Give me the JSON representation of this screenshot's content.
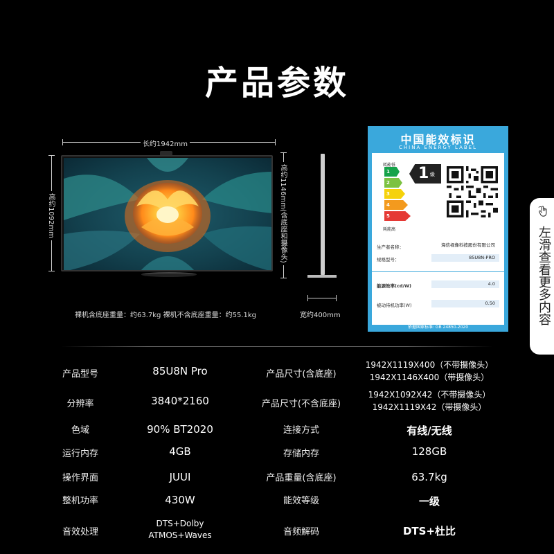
{
  "page": {
    "title": "产品参数"
  },
  "dimensions": {
    "length": "长约1942mm",
    "height_with_camera": "高约1146mm(含底座和摄像头)",
    "height": "高约1092mm",
    "depth": "宽约400mm"
  },
  "weight_note": "裸机含底座重量：约63.7kg   裸机不含底座重量：约55.1kg",
  "energy_label": {
    "title": "中国能效标识",
    "subtitle": "CHINA  ENERGY  LABEL",
    "low": "耗能低",
    "high": "耗能高",
    "grades": [
      "1",
      "2",
      "3",
      "4",
      "5"
    ],
    "grade_colors": [
      "#16a34a",
      "#7cc242",
      "#f5d20b",
      "#f39a1e",
      "#e53935"
    ],
    "badge_grade": "1",
    "badge_unit": "级",
    "manufacturer_label": "生产者名称：",
    "manufacturer": "海信视像科技股份有限公司",
    "model_label": "规格型号：",
    "model": "85U8N-PRO",
    "efficiency_label": "能源效率(cd/W)",
    "efficiency": "4.0",
    "standby_label": "被动待机功率(W)",
    "standby": "0.50",
    "footer": "依据国家标准: GB 24850-2020"
  },
  "specs": [
    {
      "label": "产品型号",
      "value": "85U8N Pro",
      "label2": "产品尺寸(含底座)",
      "value2": [
        "1942X1119X400（不带摄像头）",
        "1942X1146X400（带摄像头）"
      ]
    },
    {
      "label": "分辨率",
      "value": "3840*2160",
      "label2": "产品尺寸(不含底座)",
      "value2": [
        "1942X1092X42（不带摄像头）",
        "1942X1119X42（带摄像头）"
      ]
    },
    {
      "label": "色域",
      "value": "90% BT2020",
      "label2": "连接方式",
      "value2": [
        "有线/无线"
      ]
    },
    {
      "label": "运行内存",
      "value": "4GB",
      "label2": "存储内存",
      "value2": [
        "128GB"
      ]
    },
    {
      "label": "操作界面",
      "value": "JUUI",
      "label2": "产品重量(含底座)",
      "value2": [
        "63.7kg"
      ]
    },
    {
      "label": "整机功率",
      "value": "430W",
      "label2": "能效等级",
      "value2": [
        "一级"
      ]
    },
    {
      "label": "音效处理",
      "value": [
        "DTS+Dolby",
        "ATMOS+Waves"
      ],
      "label2": "音频解码",
      "value2": [
        "DTS+杜比"
      ]
    }
  ],
  "side_tab": {
    "text": "左滑查看更多内容",
    "icon": "swipe-hand-icon"
  }
}
